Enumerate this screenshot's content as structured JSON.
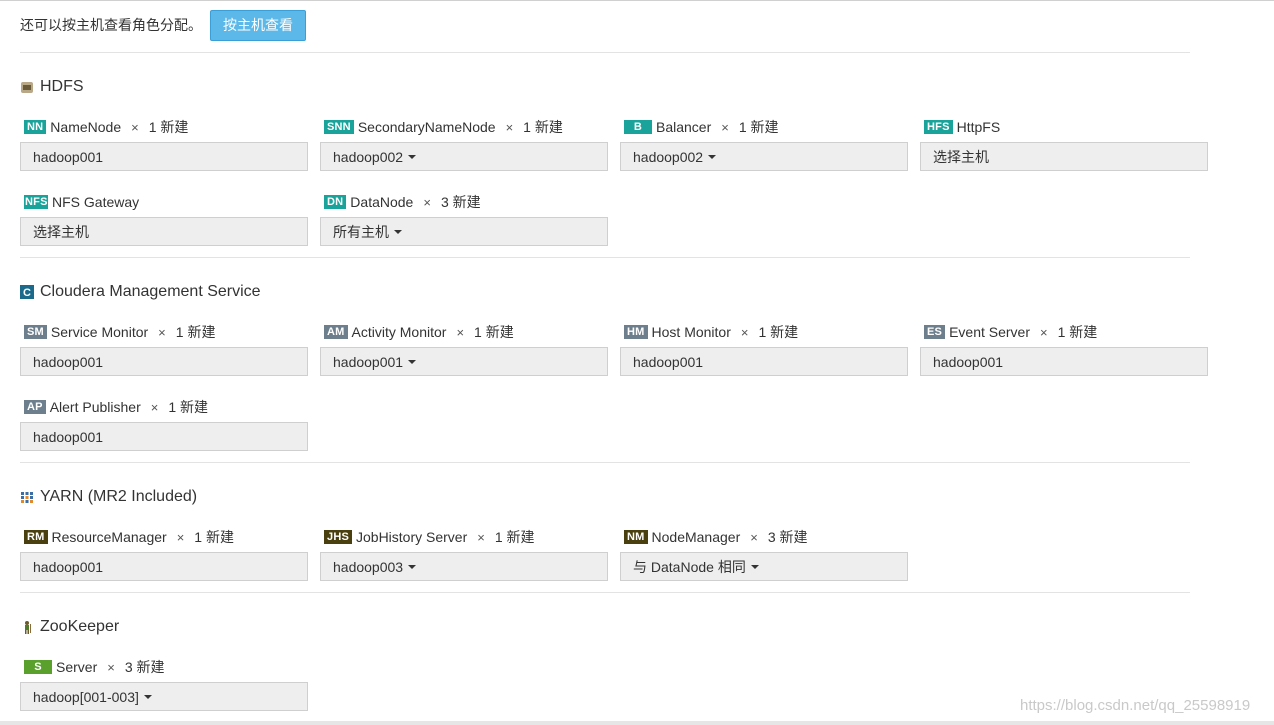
{
  "top": {
    "text": "还可以按主机查看角色分配。",
    "button": "按主机查看"
  },
  "colors": {
    "hdfs_badge": "#1aa39a",
    "cms_badge": "#6d7f8c",
    "yarn_badge": "#4a3f0f",
    "zk_badge": "#5aa02c"
  },
  "hdfs": {
    "title": "HDFS",
    "roles": [
      {
        "badge": "NN",
        "name": "NameNode",
        "x": "×",
        "count": "1 新建",
        "host": "hadoop001"
      },
      {
        "badge": "SNN",
        "name": "SecondaryNameNode",
        "x": "×",
        "count": "1 新建",
        "host": "hadoop002"
      },
      {
        "badge": "B",
        "name": "Balancer",
        "x": "×",
        "count": "1 新建",
        "host": "hadoop002"
      },
      {
        "badge": "HFS",
        "name": "HttpFS",
        "host": "选择主机"
      },
      {
        "badge": "NFSG",
        "name": "NFS Gateway",
        "host": "选择主机"
      },
      {
        "badge": "DN",
        "name": "DataNode",
        "x": "×",
        "count": "3 新建",
        "host": "所有主机"
      }
    ]
  },
  "cms": {
    "title": "Cloudera Management Service",
    "roles": [
      {
        "badge": "SM",
        "name": "Service Monitor",
        "x": "×",
        "count": "1 新建",
        "host": "hadoop001"
      },
      {
        "badge": "AM",
        "name": "Activity Monitor",
        "x": "×",
        "count": "1 新建",
        "host": "hadoop001"
      },
      {
        "badge": "HM",
        "name": "Host Monitor",
        "x": "×",
        "count": "1 新建",
        "host": "hadoop001"
      },
      {
        "badge": "ES",
        "name": "Event Server",
        "x": "×",
        "count": "1 新建",
        "host": "hadoop001"
      },
      {
        "badge": "AP",
        "name": "Alert Publisher",
        "x": "×",
        "count": "1 新建",
        "host": "hadoop001"
      }
    ]
  },
  "yarn": {
    "title": "YARN (MR2 Included)",
    "roles": [
      {
        "badge": "RM",
        "name": "ResourceManager",
        "x": "×",
        "count": "1 新建",
        "host": "hadoop001"
      },
      {
        "badge": "JHS",
        "name": "JobHistory Server",
        "x": "×",
        "count": "1 新建",
        "host": "hadoop003"
      },
      {
        "badge": "NM",
        "name": "NodeManager",
        "x": "×",
        "count": "3 新建",
        "host": "与 DataNode 相同"
      }
    ]
  },
  "zk": {
    "title": "ZooKeeper",
    "roles": [
      {
        "badge": "S",
        "name": "Server",
        "x": "×",
        "count": "3 新建",
        "host": "hadoop[001-003]"
      }
    ]
  },
  "watermark": "https://blog.csdn.net/qq_25598919"
}
